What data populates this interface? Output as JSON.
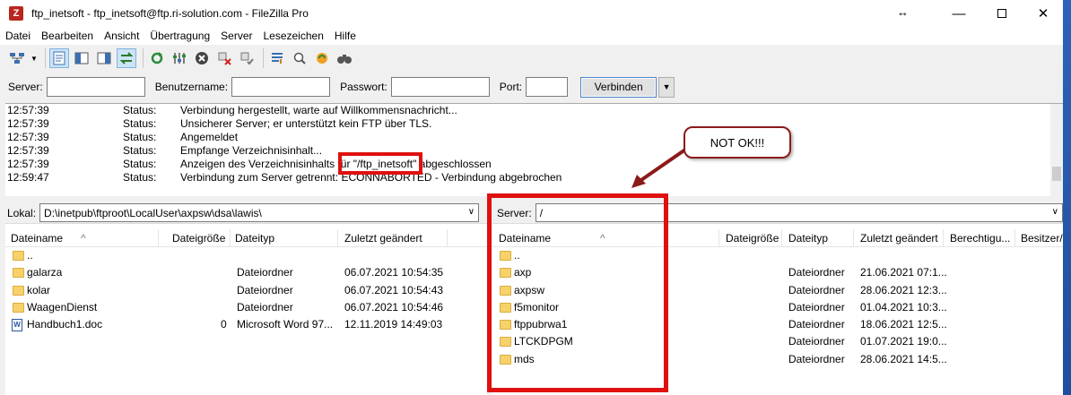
{
  "window": {
    "title": "ftp_inetsoft - ftp_inetsoft@ftp.ri-solution.com - FileZilla Pro",
    "app_icon_letter": "Z"
  },
  "menu": [
    "Datei",
    "Bearbeiten",
    "Ansicht",
    "Übertragung",
    "Server",
    "Lesezeichen",
    "Hilfe"
  ],
  "toolbar_icons": [
    "site-manager-icon",
    "dropdown-icon",
    "toggle-log-icon",
    "toggle-local-tree-icon",
    "toggle-remote-tree-icon",
    "toggle-queue-icon",
    "refresh-icon",
    "process-queue-icon",
    "cancel-icon",
    "disconnect-icon",
    "reconnect-icon",
    "compare-icon",
    "filter-icon",
    "sync-browse-icon",
    "search-icon"
  ],
  "quickconnect": {
    "server_label": "Server:",
    "username_label": "Benutzername:",
    "password_label": "Passwort:",
    "port_label": "Port:",
    "server_value": "",
    "username_value": "",
    "password_value": "",
    "port_value": "",
    "connect_label": "Verbinden"
  },
  "log": [
    {
      "time": "12:57:39",
      "type": "Status:",
      "msg": "Verbindung hergestellt, warte auf Willkommensnachricht..."
    },
    {
      "time": "12:57:39",
      "type": "Status:",
      "msg": "Unsicherer Server; er unterstützt kein FTP über TLS."
    },
    {
      "time": "12:57:39",
      "type": "Status:",
      "msg": "Angemeldet"
    },
    {
      "time": "12:57:39",
      "type": "Status:",
      "msg": "Empfange Verzeichnisinhalt..."
    },
    {
      "time": "12:57:39",
      "type": "Status:",
      "msg": "Anzeigen des Verzeichnisinhalts für \"/ftp_inetsoft\" abgeschlossen"
    },
    {
      "time": "12:59:47",
      "type": "Status:",
      "msg": "Verbindung zum Server getrennt: ECONNABORTED - Verbindung abgebrochen"
    }
  ],
  "local": {
    "label": "Lokal:",
    "path": "D:\\inetpub\\ftproot\\LocalUser\\axpsw\\dsa\\lawis\\",
    "columns": [
      "Dateiname",
      "Dateigröße",
      "Dateityp",
      "Zuletzt geändert"
    ],
    "rows": [
      {
        "name": "..",
        "size": "",
        "type": "",
        "modified": "",
        "icon": "folder"
      },
      {
        "name": "galarza",
        "size": "",
        "type": "Dateiordner",
        "modified": "06.07.2021 10:54:35",
        "icon": "folder"
      },
      {
        "name": "kolar",
        "size": "",
        "type": "Dateiordner",
        "modified": "06.07.2021 10:54:43",
        "icon": "folder"
      },
      {
        "name": "WaagenDienst",
        "size": "",
        "type": "Dateiordner",
        "modified": "06.07.2021 10:54:46",
        "icon": "folder"
      },
      {
        "name": "Handbuch1.doc",
        "size": "0",
        "type": "Microsoft Word 97...",
        "modified": "12.11.2019 14:49:03",
        "icon": "doc"
      }
    ]
  },
  "remote": {
    "label": "Server:",
    "path": "/",
    "columns": [
      "Dateiname",
      "Dateigröße",
      "Dateityp",
      "Zuletzt geändert",
      "Berechtigu...",
      "Besitzer/G"
    ],
    "rows": [
      {
        "name": "..",
        "size": "",
        "type": "",
        "modified": ""
      },
      {
        "name": "axp",
        "size": "",
        "type": "Dateiordner",
        "modified": "21.06.2021 07:1..."
      },
      {
        "name": "axpsw",
        "size": "",
        "type": "Dateiordner",
        "modified": "28.06.2021 12:3..."
      },
      {
        "name": "f5monitor",
        "size": "",
        "type": "Dateiordner",
        "modified": "01.04.2021 10:3..."
      },
      {
        "name": "ftppubrwa1",
        "size": "",
        "type": "Dateiordner",
        "modified": "18.06.2021 12:5..."
      },
      {
        "name": "LTCKDPGM",
        "size": "",
        "type": "Dateiordner",
        "modified": "01.07.2021 19:0..."
      },
      {
        "name": "mds",
        "size": "",
        "type": "Dateiordner",
        "modified": "28.06.2021 14:5..."
      }
    ]
  },
  "annotation": {
    "callout_text": "NOT OK!!!",
    "color": "#e01010"
  }
}
